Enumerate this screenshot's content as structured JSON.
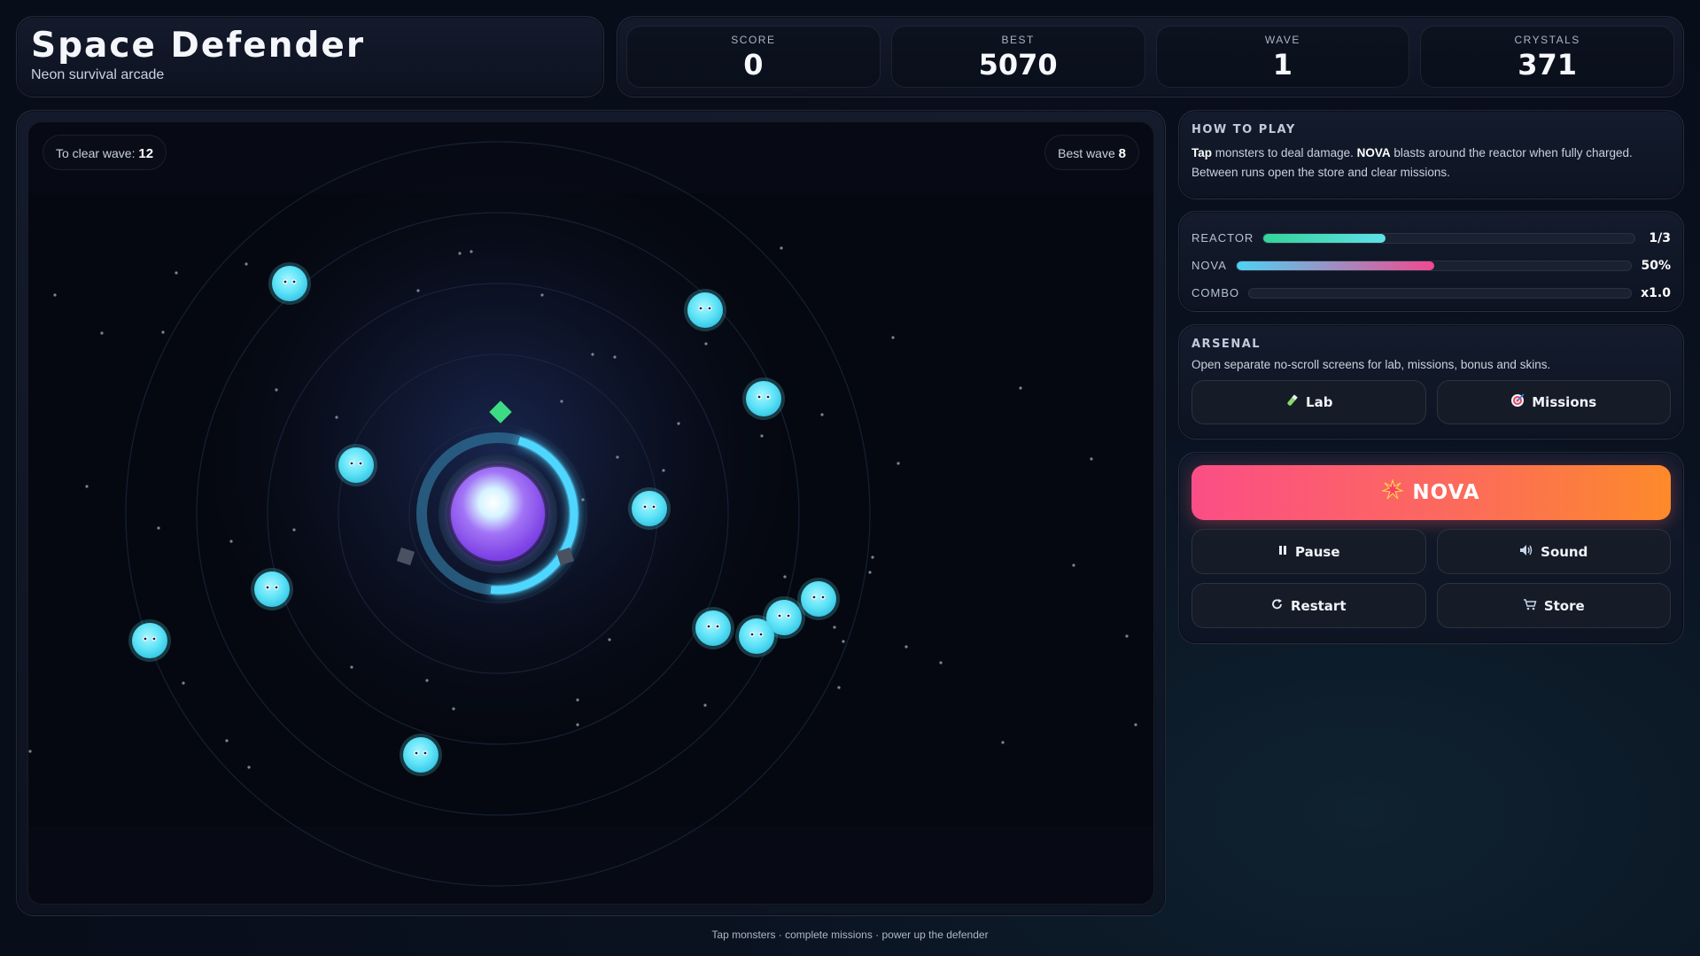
{
  "header": {
    "title": "Space Defender",
    "subtitle": "Neon survival arcade"
  },
  "stats": {
    "score_label": "SCORE",
    "score": "0",
    "best_label": "BEST",
    "best": "5070",
    "wave_label": "WAVE",
    "wave": "1",
    "crystals_label": "CRYSTALS",
    "crystals": "371"
  },
  "game": {
    "clear_label": "To clear wave:",
    "clear_value": "12",
    "best_wave_label": "Best wave",
    "best_wave_value": "8",
    "defender_charge": 0.47,
    "monsters_visible": 13
  },
  "howto": {
    "title": "HOW TO PLAY",
    "tap": "Tap",
    "text1": " monsters to deal damage. ",
    "nova": "NOVA",
    "text2": " blasts around the reactor when fully charged. Between runs open the store and clear missions."
  },
  "meters": {
    "reactor": {
      "label": "REACTOR",
      "value": "1/3",
      "fill": 0.33,
      "color_from": "#34d399",
      "color_to": "#5fe0e8"
    },
    "nova": {
      "label": "NOVA",
      "value": "50%",
      "fill": 0.5,
      "color_from": "#4fd2f4",
      "color_to": "#f0498f"
    },
    "combo": {
      "label": "COMBO",
      "value": "x1.0",
      "fill": 0
    }
  },
  "arsenal": {
    "title": "ARSENAL",
    "text": "Open separate no-scroll screens for lab, missions, bonus and skins.",
    "lab": "Lab",
    "missions": "Missions"
  },
  "controls": {
    "nova": "NOVA",
    "pause": "Pause",
    "sound": "Sound",
    "restart": "Restart",
    "store": "Store"
  },
  "colors": {
    "accent_cyan": "#5fe3f7",
    "nova_gradient_start": "#fb4e86",
    "nova_gradient_end": "#fd8a2a",
    "reactor_core": "#9c5cf6"
  },
  "footer": "Tap monsters · complete missions · power up the defender"
}
